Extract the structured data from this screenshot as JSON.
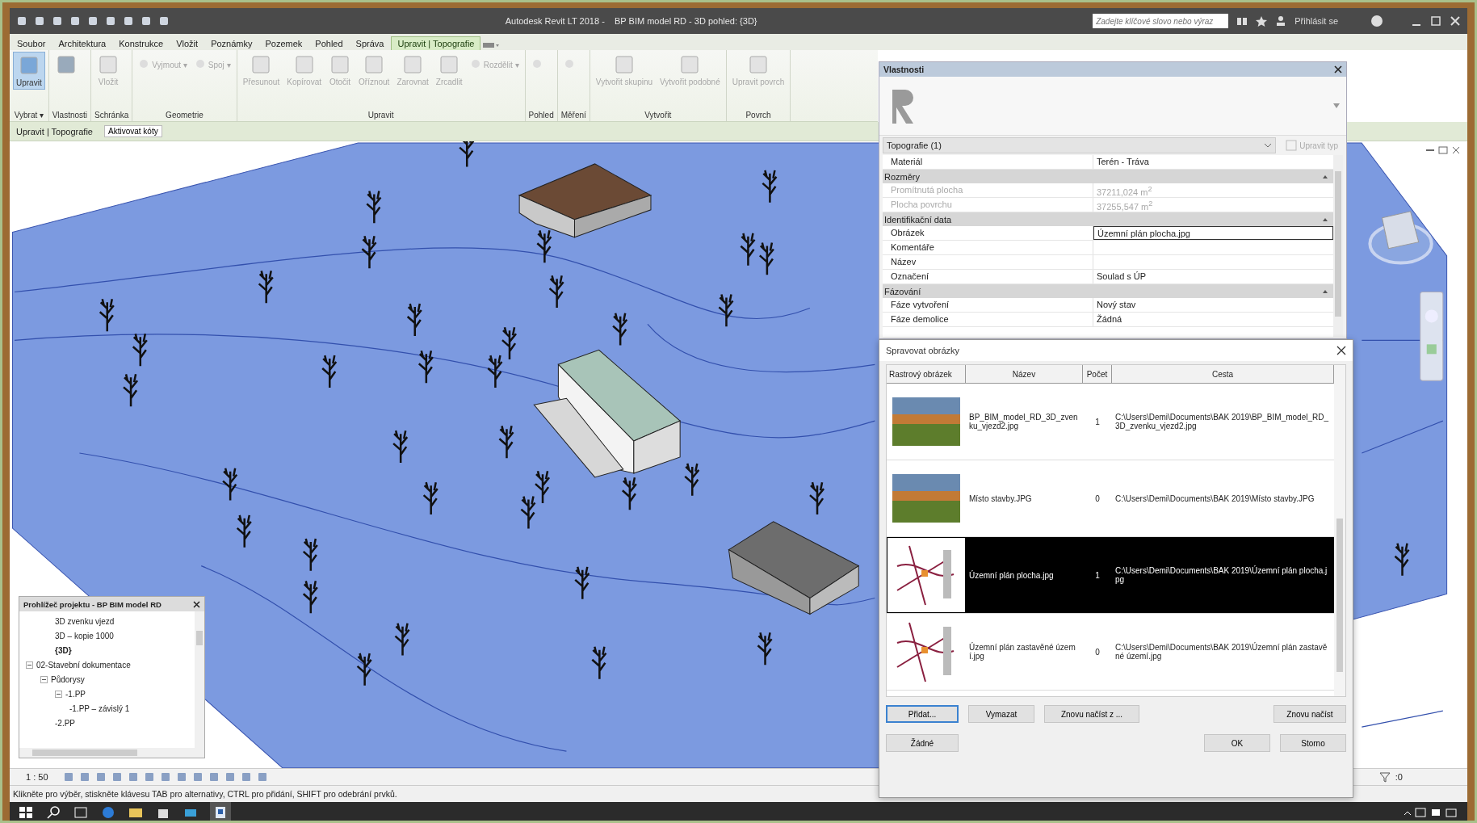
{
  "title_bar": {
    "title": "Autodesk Revit LT 2018 -    BP BIM model RD - 3D pohled: {3D}",
    "search": {
      "placeholder": "Zadejte klíčové slovo nebo výraz"
    },
    "sign_in": "Přihlásit se"
  },
  "menu_tabs": [
    {
      "label": "Soubor",
      "selected": false
    },
    {
      "label": "Architektura",
      "selected": false
    },
    {
      "label": "Konstrukce",
      "selected": false
    },
    {
      "label": "Vložit",
      "selected": false
    },
    {
      "label": "Poznámky",
      "selected": false
    },
    {
      "label": "Pozemek",
      "selected": false
    },
    {
      "label": "Pohled",
      "selected": false
    },
    {
      "label": "Správa",
      "selected": false
    },
    {
      "label": "Upravit | Topografie",
      "selected": true
    }
  ],
  "ribbon": [
    {
      "title": "Vybrat ▾",
      "tools": [
        {
          "label": "Upravit",
          "kind": "large",
          "active": true,
          "disabled": false
        }
      ]
    },
    {
      "title": "Vlastnosti",
      "tools": [
        {
          "kind": "large",
          "active": false,
          "disabled": false
        }
      ]
    },
    {
      "title": "Schránka",
      "tools": [
        {
          "label": "Vložit",
          "kind": "large",
          "active": false,
          "disabled": true
        }
      ]
    },
    {
      "title": "Geometrie",
      "tools": [
        {
          "label": "Vyjmout ▾",
          "kind": "small",
          "active": false,
          "disabled": true
        },
        {
          "label": "Spoj ▾",
          "kind": "small",
          "active": false,
          "disabled": true
        }
      ]
    },
    {
      "title": "Upravit",
      "tools": [
        {
          "label": "Přesunout",
          "kind": "large",
          "active": false,
          "disabled": true
        },
        {
          "label": "Kopírovat",
          "kind": "large",
          "active": false,
          "disabled": true
        },
        {
          "label": "Otočit",
          "kind": "large",
          "active": false,
          "disabled": true
        },
        {
          "label": "Oříznout",
          "kind": "large",
          "active": false,
          "disabled": true
        },
        {
          "label": "Zarovnat",
          "kind": "large",
          "active": false,
          "disabled": true
        },
        {
          "label": "Zrcadlit",
          "kind": "large",
          "active": false,
          "disabled": true
        },
        {
          "label": "Rozdělit ▾",
          "kind": "small",
          "active": false,
          "disabled": true
        }
      ]
    },
    {
      "title": "Pohled",
      "tools": [
        {
          "kind": "small",
          "active": false,
          "disabled": true
        }
      ]
    },
    {
      "title": "Měření",
      "tools": [
        {
          "kind": "small",
          "active": false,
          "disabled": true
        }
      ]
    },
    {
      "title": "Vytvořit",
      "tools": [
        {
          "label": "Vytvořit skupinu",
          "kind": "large",
          "active": false,
          "disabled": true
        },
        {
          "label": "Vytvořit podobné",
          "kind": "large",
          "active": false,
          "disabled": true
        }
      ]
    },
    {
      "title": "Povrch",
      "tools": [
        {
          "label": "Upravit povrch",
          "kind": "large",
          "active": false,
          "disabled": true
        }
      ]
    }
  ],
  "context_bar": {
    "label": "Upravit | Topografie",
    "button": "Aktivovat kóty"
  },
  "properties": {
    "title": "Vlastnosti",
    "type_selector": "Topografie (1)",
    "edit_type": "Upravit typ",
    "rows": [
      {
        "kind": "param",
        "name": "Materiál",
        "value": "Terén - Tráva",
        "disabled": false,
        "editing": false
      },
      {
        "kind": "group",
        "name": "Rozměry"
      },
      {
        "kind": "param",
        "name": "Promítnutá plocha",
        "value": "37211,024 m$^{2}$",
        "disabled": true,
        "editing": false
      },
      {
        "kind": "param",
        "name": "Plocha povrchu",
        "value": "37255,547 m$^{2}$",
        "disabled": true,
        "editing": false
      },
      {
        "kind": "group",
        "name": "Identifikační data"
      },
      {
        "kind": "param",
        "name": "Obrázek",
        "value": "Územní plán plocha.jpg",
        "disabled": false,
        "editing": true
      },
      {
        "kind": "param",
        "name": "Komentáře",
        "disabled": false,
        "editing": false
      },
      {
        "kind": "param",
        "name": "Název",
        "disabled": false,
        "editing": false
      },
      {
        "kind": "param",
        "name": "Označení",
        "value": "Soulad s ÚP",
        "disabled": false,
        "editing": false
      },
      {
        "kind": "group",
        "name": "Fázování"
      },
      {
        "kind": "param",
        "name": "Fáze vytvoření",
        "value": "Nový stav",
        "disabled": false,
        "editing": false
      },
      {
        "kind": "param",
        "name": "Fáze demolice",
        "value": "Žádná",
        "disabled": false,
        "editing": false
      }
    ]
  },
  "dialog": {
    "title": "Spravovat obrázky",
    "columns": [
      "Rastrový obrázek",
      "Název",
      "Počet",
      "Cesta"
    ],
    "rows": [
      {
        "kind": "photo",
        "name": "BP_BIM_model_RD_3D_zvenku_vjezd2.jpg",
        "count": "1",
        "path": "C:\\Users\\Demi\\Documents\\BAK 2019\\BP_BIM_model_RD_3D_zvenku_vjezd2.jpg",
        "selected": false
      },
      {
        "kind": "photo",
        "name": "Místo stavby.JPG",
        "count": "0",
        "path": "C:\\Users\\Demi\\Documents\\BAK 2019\\Místo stavby.JPG",
        "selected": false
      },
      {
        "kind": "plan",
        "name": "Územní plán plocha.jpg",
        "count": "1",
        "path": "C:\\Users\\Demi\\Documents\\BAK 2019\\Územní plán plocha.jpg",
        "selected": true
      },
      {
        "kind": "plan",
        "name": "Územní plán zastavěné území.jpg",
        "count": "0",
        "path": "C:\\Users\\Demi\\Documents\\BAK 2019\\Územní plán zastavěné území.jpg",
        "selected": false
      }
    ],
    "row_buttons": [
      {
        "label": "Přidat...",
        "focused": true
      },
      {
        "label": "Vymazat",
        "focused": false
      },
      {
        "label": "Znovu načíst z ...",
        "focused": false
      },
      {
        "label": "Znovu načíst",
        "focused": false
      }
    ],
    "footer_buttons": [
      {
        "label": "Žádné",
        "focused": false
      },
      {
        "label": "OK",
        "focused": false
      },
      {
        "label": "Storno",
        "focused": false
      }
    ]
  },
  "project_browser": {
    "title": "Prohlížeč projektu - BP BIM model RD",
    "tree": [
      {
        "children": [
          {
            "children": [
              {
                "label": "3D zvenku vjezd",
                "current": false
              },
              {
                "label": "3D – kopie 1000",
                "current": false
              },
              {
                "label": "{3D}",
                "current": true
              }
            ]
          }
        ]
      },
      {
        "label": "02-Stavební dokumentace",
        "expanded": true,
        "current": false,
        "children": [
          {
            "label": "Půdorysy",
            "expanded": true,
            "current": false,
            "children": [
              {
                "label": "-1.PP",
                "expanded": true,
                "current": false,
                "children": [
                  {
                    "label": "-1.PP – závislý 1",
                    "current": false
                  }
                ]
              },
              {
                "label": "-2.PP",
                "current": false
              }
            ]
          }
        ]
      }
    ]
  },
  "view_control_bar": {
    "scale": "1 : 50",
    "selection_count": ":0"
  },
  "status_bar": {
    "text": "Klikněte pro výběr, stiskněte klávesu TAB pro alternativy, CTRL pro přidání, SHIFT pro odebrání prvků."
  }
}
